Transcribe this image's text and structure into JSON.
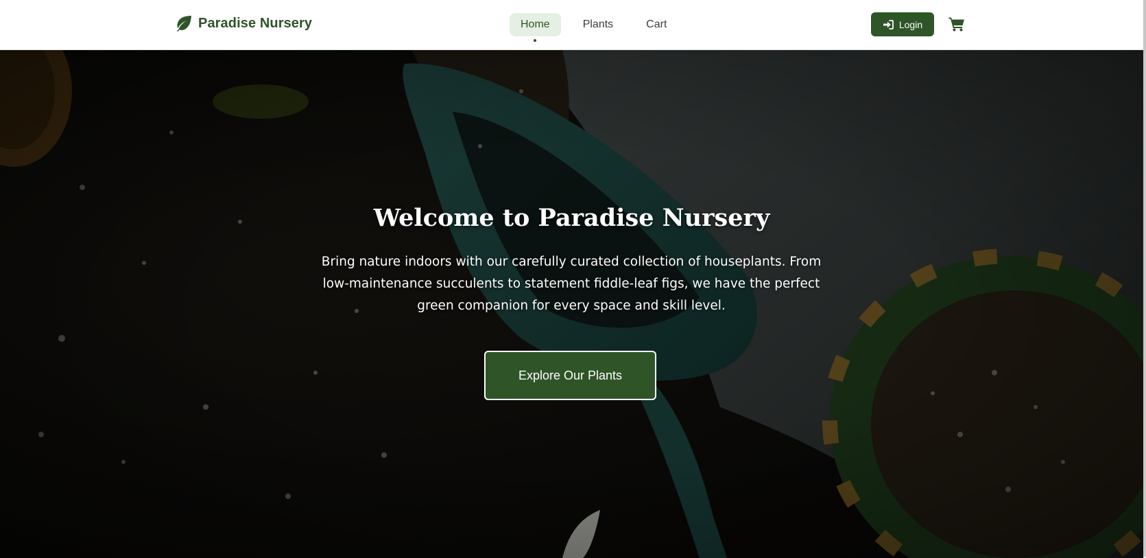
{
  "brand": {
    "name": "Paradise Nursery",
    "icon": "leaf-icon",
    "color": "#2e5428"
  },
  "nav": {
    "items": [
      {
        "label": "Home",
        "active": true
      },
      {
        "label": "Plants",
        "active": false
      },
      {
        "label": "Cart",
        "active": false
      }
    ]
  },
  "actions": {
    "login_label": "Login",
    "login_icon": "sign-in-icon",
    "cart_icon": "shopping-cart-icon"
  },
  "hero": {
    "title": "Welcome to Paradise Nursery",
    "description": "Bring nature indoors with our carefully curated collection of houseplants. From low-maintenance succulents to statement fiddle-leaf figs, we have the perfect green companion for every space and skill level.",
    "cta_label": "Explore Our Plants"
  },
  "colors": {
    "primary": "#2e5428",
    "nav_active_bg": "#e6efe3",
    "text": "#3d3d3d"
  }
}
